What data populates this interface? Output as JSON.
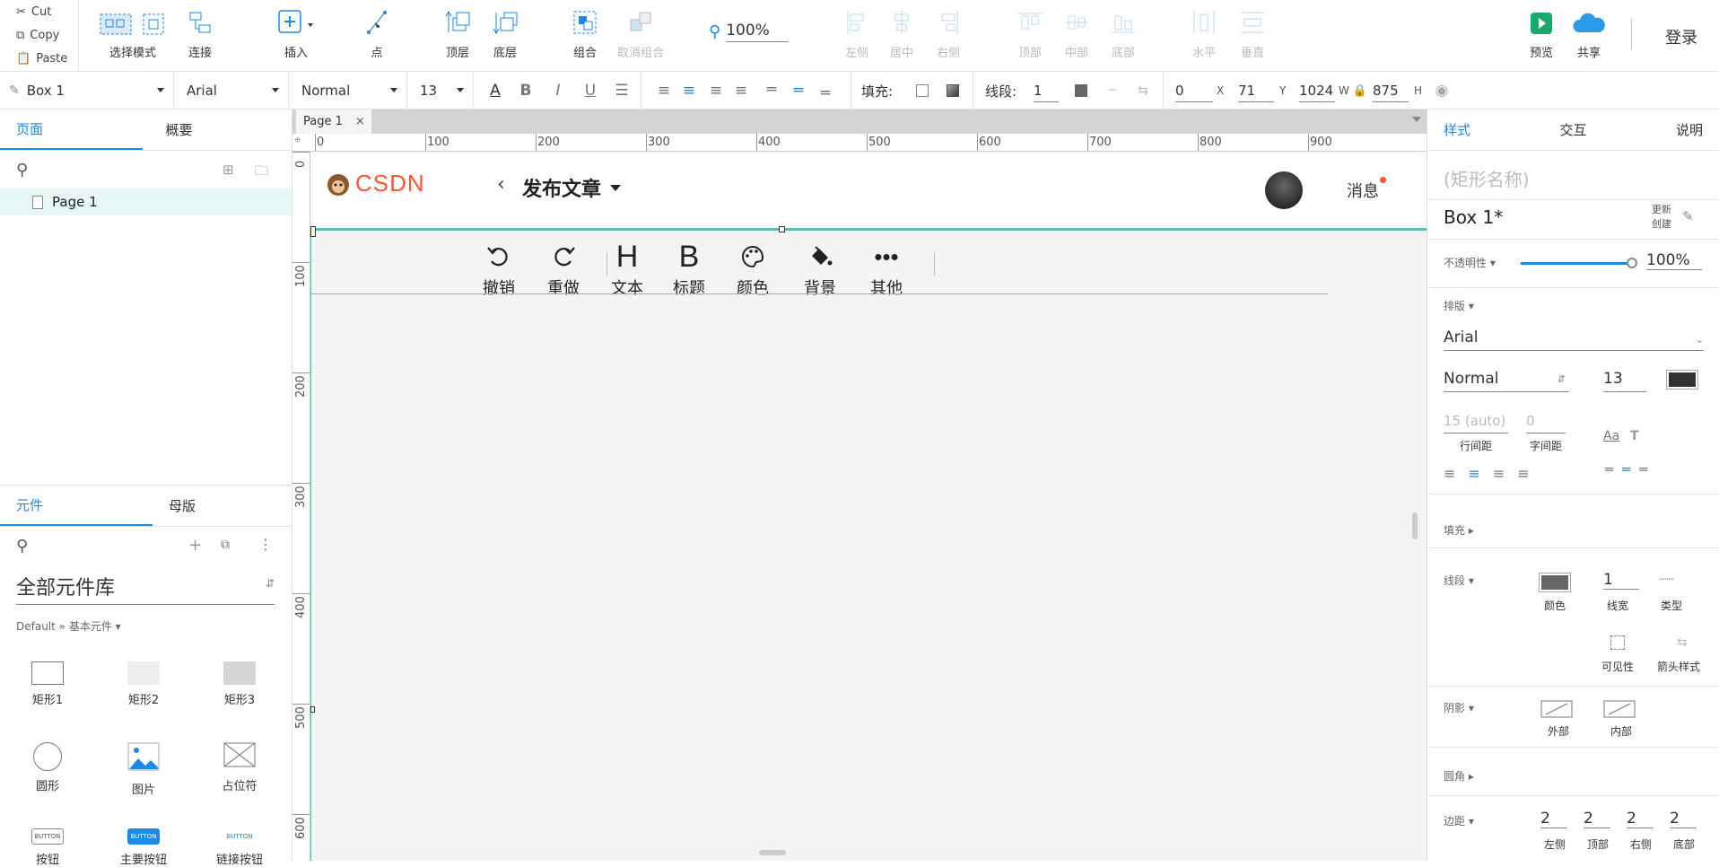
{
  "clipboard": {
    "cut": "Cut",
    "copy": "Copy",
    "paste": "Paste"
  },
  "toolbar": {
    "select_mode": "选择模式",
    "connect": "连接",
    "insert": "插入",
    "point": "点",
    "top_layer": "顶层",
    "bottom_layer": "底层",
    "group": "组合",
    "ungroup": "取消组合",
    "zoom": "100%",
    "align_left": "左侧",
    "align_center": "居中",
    "align_right": "右侧",
    "align_top": "顶部",
    "align_middle": "中部",
    "align_bottom": "底部",
    "dist_h": "水平",
    "dist_v": "垂直",
    "preview": "预览",
    "share": "共享",
    "login": "登录"
  },
  "format": {
    "shape": "Box 1",
    "font": "Arial",
    "weight": "Normal",
    "size": "13",
    "fill_label": "填充:",
    "line_label": "线段:",
    "line_width": "1",
    "x": "0",
    "x_label": "X",
    "y": "71",
    "y_label": "Y",
    "w": "1024",
    "w_label": "W",
    "h": "875",
    "h_label": "H"
  },
  "left": {
    "tab_pages": "页面",
    "tab_outline": "概要",
    "page1": "Page 1",
    "tab_widgets": "元件",
    "tab_masters": "母版",
    "library_title": "全部元件库",
    "library_path": "Default » 基本元件 ▾",
    "widgets": [
      "矩形1",
      "矩形2",
      "矩形3",
      "圆形",
      "图片",
      "占位符",
      "按钮",
      "主要按钮",
      "链接按钮"
    ],
    "button_text": "BUTTON"
  },
  "canvas": {
    "doc_tab": "Page 1",
    "ruler_h": [
      "0",
      "100",
      "200",
      "300",
      "400",
      "500",
      "600",
      "700",
      "800",
      "900"
    ],
    "ruler_v": [
      "0",
      "100",
      "200",
      "300",
      "400",
      "500",
      "600"
    ]
  },
  "mock": {
    "logo": "CSDN",
    "title": "发布文章",
    "messages": "消息",
    "buttons": [
      "撤销",
      "重做",
      "文本",
      "标题",
      "颜色",
      "背景",
      "其他"
    ]
  },
  "right": {
    "tab_style": "样式",
    "tab_interact": "交互",
    "tab_notes": "说明",
    "shape_name_placeholder": "(矩形名称)",
    "shape_name": "Box 1*",
    "update_label": "更新",
    "create_label": "创建",
    "opacity_label": "不透明性 ▾",
    "opacity": "100%",
    "typography_label": "排版 ▾",
    "font": "Arial",
    "weight": "Normal",
    "size": "13",
    "line_height": "15 (auto)",
    "letter_spacing": "0",
    "line_height_label": "行间距",
    "letter_spacing_label": "字间距",
    "fill_label": "填充 ▸",
    "border_label": "线段 ▾",
    "border_width": "1",
    "border_color_label": "颜色",
    "border_width_label": "线宽",
    "border_type_label": "类型",
    "visibility_label": "可见性",
    "arrow_label": "箭头样式",
    "shadow_label": "阴影 ▾",
    "shadow_outer": "外部",
    "shadow_inner": "内部",
    "radius_label": "圆角 ▸",
    "padding_label": "边距 ▾",
    "padding": [
      "2",
      "2",
      "2",
      "2"
    ],
    "padding_labels": [
      "左侧",
      "顶部",
      "右侧",
      "底部"
    ]
  },
  "colors": {
    "accent": "#1e88e5",
    "teal": "#5bbcb4",
    "csdn_red": "#fc5531"
  }
}
